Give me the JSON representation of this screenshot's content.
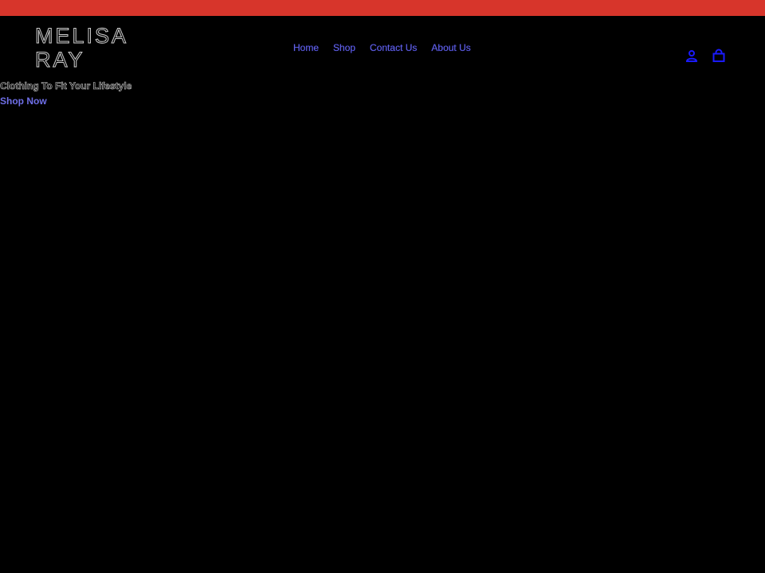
{
  "announcement_bar": {
    "color": "#d7352b"
  },
  "brand": {
    "line1": "MELISA",
    "line2": "RAY"
  },
  "nav": {
    "items": [
      {
        "label": "Home"
      },
      {
        "label": "Shop"
      },
      {
        "label": "Contact Us"
      },
      {
        "label": "About Us"
      }
    ],
    "link_color": "#6f6fe8"
  },
  "header_icons": {
    "account": "account-icon",
    "cart": "cart-icon",
    "color": "#1a1aff"
  },
  "hero": {
    "title": "Clothing To Fit Your Lifestyle",
    "cta": "Shop Now"
  }
}
